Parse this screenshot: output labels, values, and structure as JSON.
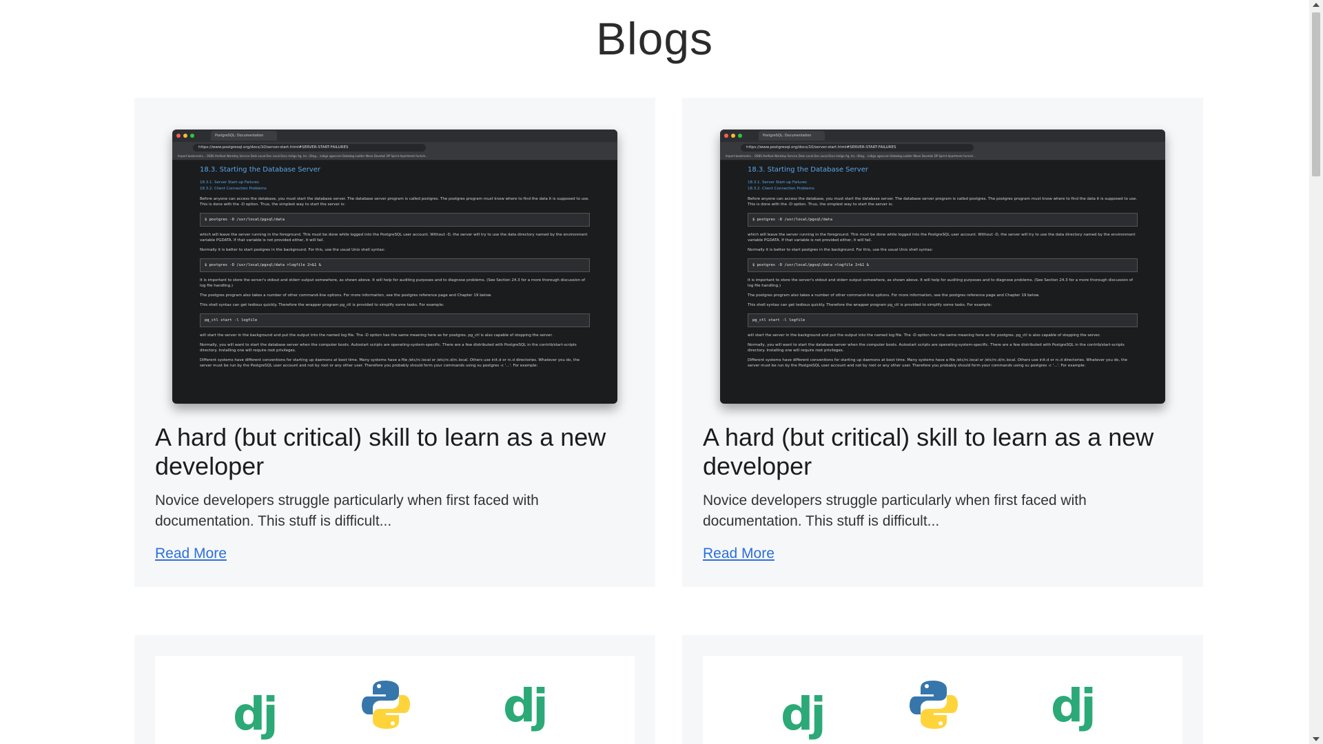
{
  "page": {
    "title": "Blogs"
  },
  "colors": {
    "card_bg": "#f6f7f9",
    "link": "#2a6fdb",
    "django_green": "#2ba977",
    "python_blue": "#3776ab",
    "python_yellow": "#ffd43b"
  },
  "posts": [
    {
      "title": "A hard (but critical) skill to learn as a new developer",
      "excerpt": "Novice developers struggle particularly when first faced with documentation. This stuff is difficult...",
      "read_more": "Read More",
      "thumbnail": {
        "tab": "PostgreSQL: Documentation",
        "url": "https://www.postgresql.org/docs/10/server-start.html#SERVER-START-FAILURES",
        "bookmarks": "Import bookmarks...  OSBS  thelfoot  Workday  Service Desk  Local Dev  Local Docs  Indigo Ag, Inc. (Stag...  indigo agaccom  Datadog  Ladder  Wave  Dovetail  DP  Sprint  Apartment furnish...",
        "heading": "18.3. Starting the Database Server",
        "links": [
          "18.3.1. Server Start-up Failures",
          "18.3.2. Client Connection Problems"
        ],
        "p1": "Before anyone can access the database, you must start the database server. The database server program is called postgres. The postgres program must know where to find the data it is supposed to use. This is done with the -D option. Thus, the simplest way to start the server is:",
        "code1": "$ postgres -D /usr/local/pgsql/data",
        "p2": "which will leave the server running in the foreground. This must be done while logged into the PostgreSQL user account. Without -D, the server will try to use the data directory named by the environment variable PGDATA. If that variable is not provided either, it will fail.",
        "p3": "Normally it is better to start postgres in the background. For this, use the usual Unix shell syntax:",
        "code2": "$ postgres -D /usr/local/pgsql/data >logfile 2>&1 &",
        "p4": "It is important to store the server's stdout and stderr output somewhere, as shown above. It will help for auditing purposes and to diagnose problems. (See Section 24.3 for a more thorough discussion of log file handling.)",
        "p5": "The postgres program also takes a number of other command-line options. For more information, see the postgres reference page and Chapter 19 below.",
        "p6": "This shell syntax can get tedious quickly. Therefore the wrapper program pg_ctl is provided to simplify some tasks. For example:",
        "code3": "pg_ctl start -l logfile",
        "p7": "will start the server in the background and put the output into the named log file. The -D option has the same meaning here as for postgres. pg_ctl is also capable of stopping the server.",
        "p8": "Normally, you will want to start the database server when the computer boots. Autostart scripts are operating-system-specific. There are a few distributed with PostgreSQL in the contrib/start-scripts directory. Installing one will require root privileges.",
        "p9": "Different systems have different conventions for starting up daemons at boot time. Many systems have a file /etc/rc.local or /etc/rc.d/rc.local. Others use init.d or rc.d directories. Whatever you do, the server must be run by the PostgreSQL user account and not by root or any other user. Therefore you probably should form your commands using su postgres -c '...'. For example:"
      }
    },
    {
      "title": "A hard (but critical) skill to learn as a new developer",
      "excerpt": "Novice developers struggle particularly when first faced with documentation. This stuff is difficult...",
      "read_more": "Read More"
    },
    {
      "logos": [
        "dj",
        "python-logo",
        "dj"
      ]
    },
    {
      "logos": [
        "dj",
        "python-logo",
        "dj"
      ]
    }
  ]
}
